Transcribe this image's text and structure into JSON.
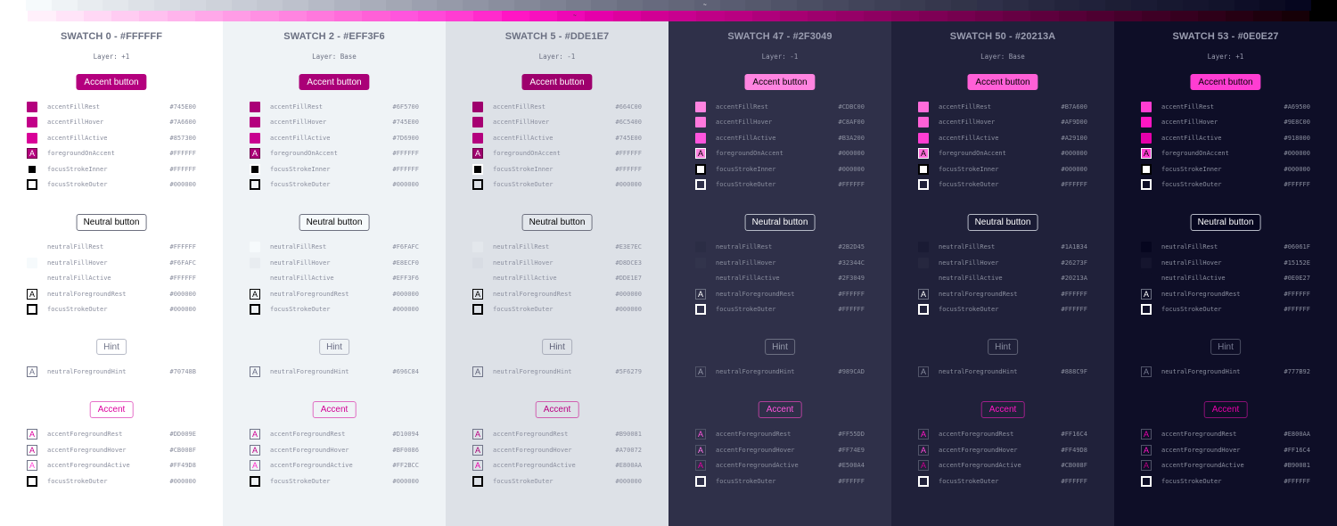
{
  "neutral_ramp": [
    "#FFFFFF",
    "#F6FAFC",
    "#EFF3F6",
    "#E8ECF0",
    "#E3E7EC",
    "#DDE1E7",
    "#D8DCE3",
    "#D3D7DF",
    "#CED2DA",
    "#C8CCD6",
    "#C3C7D1",
    "#BDC1CC",
    "#B6BAC6",
    "#AFB3C0",
    "#A9ADBA",
    "#A3A7B4",
    "#9CA0AF",
    "#969AA9",
    "#9094A4",
    "#8A8E9E",
    "#848898",
    "#7E8293",
    "#787C8D",
    "#727688",
    "#6C7082",
    "#676A7E",
    "#636679",
    "#5E6175",
    "#595C71",
    "#55586C",
    "#505368",
    "#4B4E63",
    "#47495F",
    "#42445A",
    "#3E4056",
    "#3A3C51",
    "#36374D",
    "#323449",
    "#2F3049",
    "#2B2C44",
    "#272840",
    "#23243C",
    "#20213A",
    "#1D1E35",
    "#1A1B34",
    "#171830",
    "#15152E",
    "#12132B",
    "#0E0E27",
    "#0B0B22",
    "#06061F",
    "#000000"
  ],
  "accent_ramp": [
    "#FFFFFF",
    "#FFF0FB",
    "#FFE4F8",
    "#FFD8F5",
    "#FFCCF2",
    "#FFC0EF",
    "#FFB4EC",
    "#FFA8E9",
    "#FF9CE6",
    "#FF90E3",
    "#FF84E0",
    "#FF78DD",
    "#FF6CDA",
    "#FF60D7",
    "#FF55DD",
    "#FF49D8",
    "#FF3DD2",
    "#FF2BCC",
    "#FF16C4",
    "#F810BE",
    "#EE08B5",
    "#E500AA",
    "#DD009E",
    "#D10094",
    "#C8008F",
    "#BF0086",
    "#B90081",
    "#AF007B",
    "#A70072",
    "#9E006D",
    "#960067",
    "#8E0061",
    "#86005B",
    "#7E0055",
    "#76004F",
    "#6E0049",
    "#660043",
    "#5E003D",
    "#560037",
    "#4E0031",
    "#46002B",
    "#3E0025",
    "#36001F",
    "#2E0019",
    "#260013",
    "#1E000D",
    "#160007",
    "#000000"
  ],
  "markers": {
    "neutral": "~",
    "accent": "~"
  },
  "columns": [
    {
      "title": "SWATCH 0 - #FFFFFF",
      "layer": "Layer: +1",
      "theme": {
        "bg": "#FFFFFF",
        "title": "#6B7082",
        "text": "#8A8E9E",
        "layer": "#6B7082",
        "accent_btn_bg": "#B4007E",
        "accent_btn_fg": "#FFFFFF",
        "neutral_btn_bg": "#FFFFFF",
        "neutral_btn_fg": "#000000",
        "neutral_btn_border": "#6E7180",
        "hint_fg": "#707488",
        "hint_border": "#B6BAC6",
        "accentfg_fg": "#DD009E",
        "accentfg_border": "#E66FC8",
        "dark": false
      },
      "accent_button": "Accent button",
      "accent_rows": [
        {
          "name": "accentFillRest",
          "value": "#745E00",
          "color": "#B4007E"
        },
        {
          "name": "accentFillHover",
          "value": "#7A6600",
          "color": "#C30089"
        },
        {
          "name": "accentFillActive",
          "value": "#857300",
          "color": "#D90098"
        },
        {
          "name": "foregroundOnAccent",
          "value": "#FFFFFF",
          "glyph": "A"
        },
        {
          "name": "focusStrokeInner",
          "value": "#FFFFFF"
        },
        {
          "name": "focusStrokeOuter",
          "value": "#000000"
        }
      ],
      "neutral_button": "Neutral button",
      "neutral_rows": [
        {
          "name": "neutralFillRest",
          "value": "#FFFFFF",
          "color": "#FFFFFF"
        },
        {
          "name": "neutralFillHover",
          "value": "#F6FAFC",
          "color": "#F6FAFC"
        },
        {
          "name": "neutralFillActive",
          "value": "#FFFFFF",
          "color": "#FFFFFF"
        },
        {
          "name": "neutralForegroundRest",
          "value": "#000000",
          "glyph": "A"
        },
        {
          "name": "focusStrokeOuter",
          "value": "#000000"
        }
      ],
      "hint_button": "Hint",
      "hint_rows": [
        {
          "name": "neutralForegroundHint",
          "value": "#70748B",
          "glyph": "A"
        }
      ],
      "accentfg_button": "Accent",
      "accentfg_rows": [
        {
          "name": "accentForegroundRest",
          "value": "#DD009E",
          "glyph": "A",
          "color": "#DD009E"
        },
        {
          "name": "accentForegroundHover",
          "value": "#CB008F",
          "glyph": "A",
          "color": "#CB008F"
        },
        {
          "name": "accentForegroundActive",
          "value": "#FF49D8",
          "glyph": "A",
          "color": "#FF49D8"
        },
        {
          "name": "focusStrokeOuter",
          "value": "#000000"
        }
      ]
    },
    {
      "title": "SWATCH 2 - #EFF3F6",
      "layer": "Layer: Base",
      "theme": {
        "bg": "#EFF3F6",
        "title": "#6B7082",
        "text": "#8A8E9E",
        "layer": "#6B7082",
        "accent_btn_bg": "#AA0077",
        "accent_btn_fg": "#FFFFFF",
        "neutral_btn_bg": "#F6FAFC",
        "neutral_btn_fg": "#000000",
        "neutral_btn_border": "#6E7180",
        "hint_fg": "#696C84",
        "hint_border": "#B6BAC6",
        "accentfg_fg": "#D10094",
        "accentfg_border": "#E06CC2",
        "dark": false
      },
      "accent_button": "Accent button",
      "accent_rows": [
        {
          "name": "accentFillRest",
          "value": "#6F5700",
          "color": "#AA0077"
        },
        {
          "name": "accentFillHover",
          "value": "#745E00",
          "color": "#B4007E"
        },
        {
          "name": "accentFillActive",
          "value": "#7D6900",
          "color": "#C80090"
        },
        {
          "name": "foregroundOnAccent",
          "value": "#FFFFFF",
          "glyph": "A"
        },
        {
          "name": "focusStrokeInner",
          "value": "#FFFFFF"
        },
        {
          "name": "focusStrokeOuter",
          "value": "#000000"
        }
      ],
      "neutral_button": "Neutral button",
      "neutral_rows": [
        {
          "name": "neutralFillRest",
          "value": "#F6FAFC",
          "color": "#F6FAFC"
        },
        {
          "name": "neutralFillHover",
          "value": "#E8ECF0",
          "color": "#E8ECF0"
        },
        {
          "name": "neutralFillActive",
          "value": "#EFF3F6",
          "color": "#EFF3F6"
        },
        {
          "name": "neutralForegroundRest",
          "value": "#000000",
          "glyph": "A"
        },
        {
          "name": "focusStrokeOuter",
          "value": "#000000"
        }
      ],
      "hint_button": "Hint",
      "hint_rows": [
        {
          "name": "neutralForegroundHint",
          "value": "#696C84",
          "glyph": "A"
        }
      ],
      "accentfg_button": "Accent",
      "accentfg_rows": [
        {
          "name": "accentForegroundRest",
          "value": "#D10094",
          "glyph": "A",
          "color": "#D10094"
        },
        {
          "name": "accentForegroundHover",
          "value": "#BF0086",
          "glyph": "A",
          "color": "#BF0086"
        },
        {
          "name": "accentForegroundActive",
          "value": "#FF2BCC",
          "glyph": "A",
          "color": "#FF2BCC"
        },
        {
          "name": "focusStrokeOuter",
          "value": "#000000"
        }
      ]
    },
    {
      "title": "SWATCH 5 - #DDE1E7",
      "layer": "Layer: -1",
      "theme": {
        "bg": "#DDE1E7",
        "title": "#6B7082",
        "text": "#8A8E9E",
        "layer": "#6B7082",
        "accent_btn_bg": "#9E006D",
        "accent_btn_fg": "#FFFFFF",
        "neutral_btn_bg": "#E3E7EC",
        "neutral_btn_fg": "#000000",
        "neutral_btn_border": "#6E7180",
        "hint_fg": "#5F6279",
        "hint_border": "#A9ADBA",
        "accentfg_fg": "#B90081",
        "accentfg_border": "#D060B0",
        "dark": false
      },
      "accent_button": "Accent button",
      "accent_rows": [
        {
          "name": "accentFillRest",
          "value": "#664C00",
          "color": "#9E006D"
        },
        {
          "name": "accentFillHover",
          "value": "#6C5400",
          "color": "#A70072"
        },
        {
          "name": "accentFillActive",
          "value": "#745E00",
          "color": "#B4007E"
        },
        {
          "name": "foregroundOnAccent",
          "value": "#FFFFFF",
          "glyph": "A"
        },
        {
          "name": "focusStrokeInner",
          "value": "#FFFFFF"
        },
        {
          "name": "focusStrokeOuter",
          "value": "#000000"
        }
      ],
      "neutral_button": "Neutral button",
      "neutral_rows": [
        {
          "name": "neutralFillRest",
          "value": "#E3E7EC",
          "color": "#E3E7EC"
        },
        {
          "name": "neutralFillHover",
          "value": "#D8DCE3",
          "color": "#D8DCE3"
        },
        {
          "name": "neutralFillActive",
          "value": "#DDE1E7",
          "color": "#DDE1E7"
        },
        {
          "name": "neutralForegroundRest",
          "value": "#000000",
          "glyph": "A"
        },
        {
          "name": "focusStrokeOuter",
          "value": "#000000"
        }
      ],
      "hint_button": "Hint",
      "hint_rows": [
        {
          "name": "neutralForegroundHint",
          "value": "#5F6279",
          "glyph": "A"
        }
      ],
      "accentfg_button": "Accent",
      "accentfg_rows": [
        {
          "name": "accentForegroundRest",
          "value": "#B90081",
          "glyph": "A",
          "color": "#B90081"
        },
        {
          "name": "accentForegroundHover",
          "value": "#A70072",
          "glyph": "A",
          "color": "#A70072"
        },
        {
          "name": "accentForegroundActive",
          "value": "#E800AA",
          "glyph": "A",
          "color": "#E800AA"
        },
        {
          "name": "focusStrokeOuter",
          "value": "#000000"
        }
      ]
    },
    {
      "title": "SWATCH 47 - #2F3049",
      "layer": "Layer: -1",
      "theme": {
        "bg": "#2F3049",
        "title": "#9A9DB0",
        "text": "#8A8E9E",
        "layer": "#9A9DB0",
        "accent_btn_bg": "#FF84E0",
        "accent_btn_fg": "#000000",
        "neutral_btn_bg": "#2B2D45",
        "neutral_btn_fg": "#FFFFFF",
        "neutral_btn_border": "#B6BAC6",
        "hint_fg": "#989CAD",
        "hint_border": "#6C7082",
        "accentfg_fg": "#FF55DD",
        "accentfg_border": "#B0409A",
        "dark": true
      },
      "accent_button": "Accent button",
      "accent_rows": [
        {
          "name": "accentFillRest",
          "value": "#CDBC00",
          "color": "#FF84E0"
        },
        {
          "name": "accentFillHover",
          "value": "#C8AF00",
          "color": "#FF78DD"
        },
        {
          "name": "accentFillActive",
          "value": "#B3A200",
          "color": "#FF55DD"
        },
        {
          "name": "foregroundOnAccent",
          "value": "#000000",
          "glyph": "A"
        },
        {
          "name": "focusStrokeInner",
          "value": "#000000"
        },
        {
          "name": "focusStrokeOuter",
          "value": "#FFFFFF"
        }
      ],
      "neutral_button": "Neutral button",
      "neutral_rows": [
        {
          "name": "neutralFillRest",
          "value": "#2B2D45",
          "color": "#2B2D45"
        },
        {
          "name": "neutralFillHover",
          "value": "#32344C",
          "color": "#32344C"
        },
        {
          "name": "neutralFillActive",
          "value": "#2F3049",
          "color": "#2F3049"
        },
        {
          "name": "neutralForegroundRest",
          "value": "#FFFFFF",
          "glyph": "A"
        },
        {
          "name": "focusStrokeOuter",
          "value": "#FFFFFF"
        }
      ],
      "hint_button": "Hint",
      "hint_rows": [
        {
          "name": "neutralForegroundHint",
          "value": "#989CAD",
          "glyph": "A"
        }
      ],
      "accentfg_button": "Accent",
      "accentfg_rows": [
        {
          "name": "accentForegroundRest",
          "value": "#FF55DD",
          "glyph": "A",
          "color": "#FF55DD"
        },
        {
          "name": "accentForegroundHover",
          "value": "#FF74E9",
          "glyph": "A",
          "color": "#FF74E9"
        },
        {
          "name": "accentForegroundActive",
          "value": "#E500A4",
          "glyph": "A",
          "color": "#E500A4"
        },
        {
          "name": "focusStrokeOuter",
          "value": "#FFFFFF"
        }
      ]
    },
    {
      "title": "SWATCH 50 - #20213A",
      "layer": "Layer: Base",
      "theme": {
        "bg": "#20213A",
        "title": "#9A9DB0",
        "text": "#8A8E9E",
        "layer": "#9A9DB0",
        "accent_btn_bg": "#FF60D7",
        "accent_btn_fg": "#000000",
        "neutral_btn_bg": "#1A1B34",
        "neutral_btn_fg": "#FFFFFF",
        "neutral_btn_border": "#B6BAC6",
        "hint_fg": "#888C9F",
        "hint_border": "#5E6175",
        "accentfg_fg": "#FF16C4",
        "accentfg_border": "#A0208A",
        "dark": true
      },
      "accent_button": "Accent button",
      "accent_rows": [
        {
          "name": "accentFillRest",
          "value": "#B7A600",
          "color": "#FF6CDA"
        },
        {
          "name": "accentFillHover",
          "value": "#AF9D00",
          "color": "#FF60D7"
        },
        {
          "name": "accentFillActive",
          "value": "#A29100",
          "color": "#FF3DD2"
        },
        {
          "name": "foregroundOnAccent",
          "value": "#000000",
          "glyph": "A"
        },
        {
          "name": "focusStrokeInner",
          "value": "#000000"
        },
        {
          "name": "focusStrokeOuter",
          "value": "#FFFFFF"
        }
      ],
      "neutral_button": "Neutral button",
      "neutral_rows": [
        {
          "name": "neutralFillRest",
          "value": "#1A1B34",
          "color": "#1A1B34"
        },
        {
          "name": "neutralFillHover",
          "value": "#26273F",
          "color": "#26273F"
        },
        {
          "name": "neutralFillActive",
          "value": "#20213A",
          "color": "#20213A"
        },
        {
          "name": "neutralForegroundRest",
          "value": "#FFFFFF",
          "glyph": "A"
        },
        {
          "name": "focusStrokeOuter",
          "value": "#FFFFFF"
        }
      ],
      "hint_button": "Hint",
      "hint_rows": [
        {
          "name": "neutralForegroundHint",
          "value": "#888C9F",
          "glyph": "A"
        }
      ],
      "accentfg_button": "Accent",
      "accentfg_rows": [
        {
          "name": "accentForegroundRest",
          "value": "#FF16C4",
          "glyph": "A",
          "color": "#FF16C4"
        },
        {
          "name": "accentForegroundHover",
          "value": "#FF49D8",
          "glyph": "A",
          "color": "#FF49D8"
        },
        {
          "name": "accentForegroundActive",
          "value": "#CB008F",
          "glyph": "A",
          "color": "#CB008F"
        },
        {
          "name": "focusStrokeOuter",
          "value": "#FFFFFF"
        }
      ]
    },
    {
      "title": "SWATCH 53 - #0E0E27",
      "layer": "Layer: +1",
      "theme": {
        "bg": "#0E0E27",
        "title": "#9A9DB0",
        "text": "#8A8E9E",
        "layer": "#9A9DB0",
        "accent_btn_bg": "#FF3DD2",
        "accent_btn_fg": "#000000",
        "neutral_btn_bg": "#06061F",
        "neutral_btn_fg": "#FFFFFF",
        "neutral_btn_border": "#B6BAC6",
        "hint_fg": "#777B92",
        "hint_border": "#4B4E63",
        "accentfg_fg": "#E800AA",
        "accentfg_border": "#8A1075",
        "dark": true
      },
      "accent_button": "Accent button",
      "accent_rows": [
        {
          "name": "accentFillRest",
          "value": "#A69500",
          "color": "#FF3DD2"
        },
        {
          "name": "accentFillHover",
          "value": "#9E8C00",
          "color": "#FF16C4"
        },
        {
          "name": "accentFillActive",
          "value": "#918000",
          "color": "#E500AA"
        },
        {
          "name": "foregroundOnAccent",
          "value": "#000000",
          "glyph": "A"
        },
        {
          "name": "focusStrokeInner",
          "value": "#000000"
        },
        {
          "name": "focusStrokeOuter",
          "value": "#FFFFFF"
        }
      ],
      "neutral_button": "Neutral button",
      "neutral_rows": [
        {
          "name": "neutralFillRest",
          "value": "#06061F",
          "color": "#06061F"
        },
        {
          "name": "neutralFillHover",
          "value": "#15152E",
          "color": "#15152E"
        },
        {
          "name": "neutralFillActive",
          "value": "#0E0E27",
          "color": "#0E0E27"
        },
        {
          "name": "neutralForegroundRest",
          "value": "#FFFFFF",
          "glyph": "A"
        },
        {
          "name": "focusStrokeOuter",
          "value": "#FFFFFF"
        }
      ],
      "hint_button": "Hint",
      "hint_rows": [
        {
          "name": "neutralForegroundHint",
          "value": "#777B92",
          "glyph": "A"
        }
      ],
      "accentfg_button": "Accent",
      "accentfg_rows": [
        {
          "name": "accentForegroundRest",
          "value": "#E800AA",
          "glyph": "A",
          "color": "#E800AA"
        },
        {
          "name": "accentForegroundHover",
          "value": "#FF16C4",
          "glyph": "A",
          "color": "#FF16C4"
        },
        {
          "name": "accentForegroundActive",
          "value": "#B90081",
          "glyph": "A",
          "color": "#B90081"
        },
        {
          "name": "focusStrokeOuter",
          "value": "#FFFFFF"
        }
      ]
    }
  ]
}
